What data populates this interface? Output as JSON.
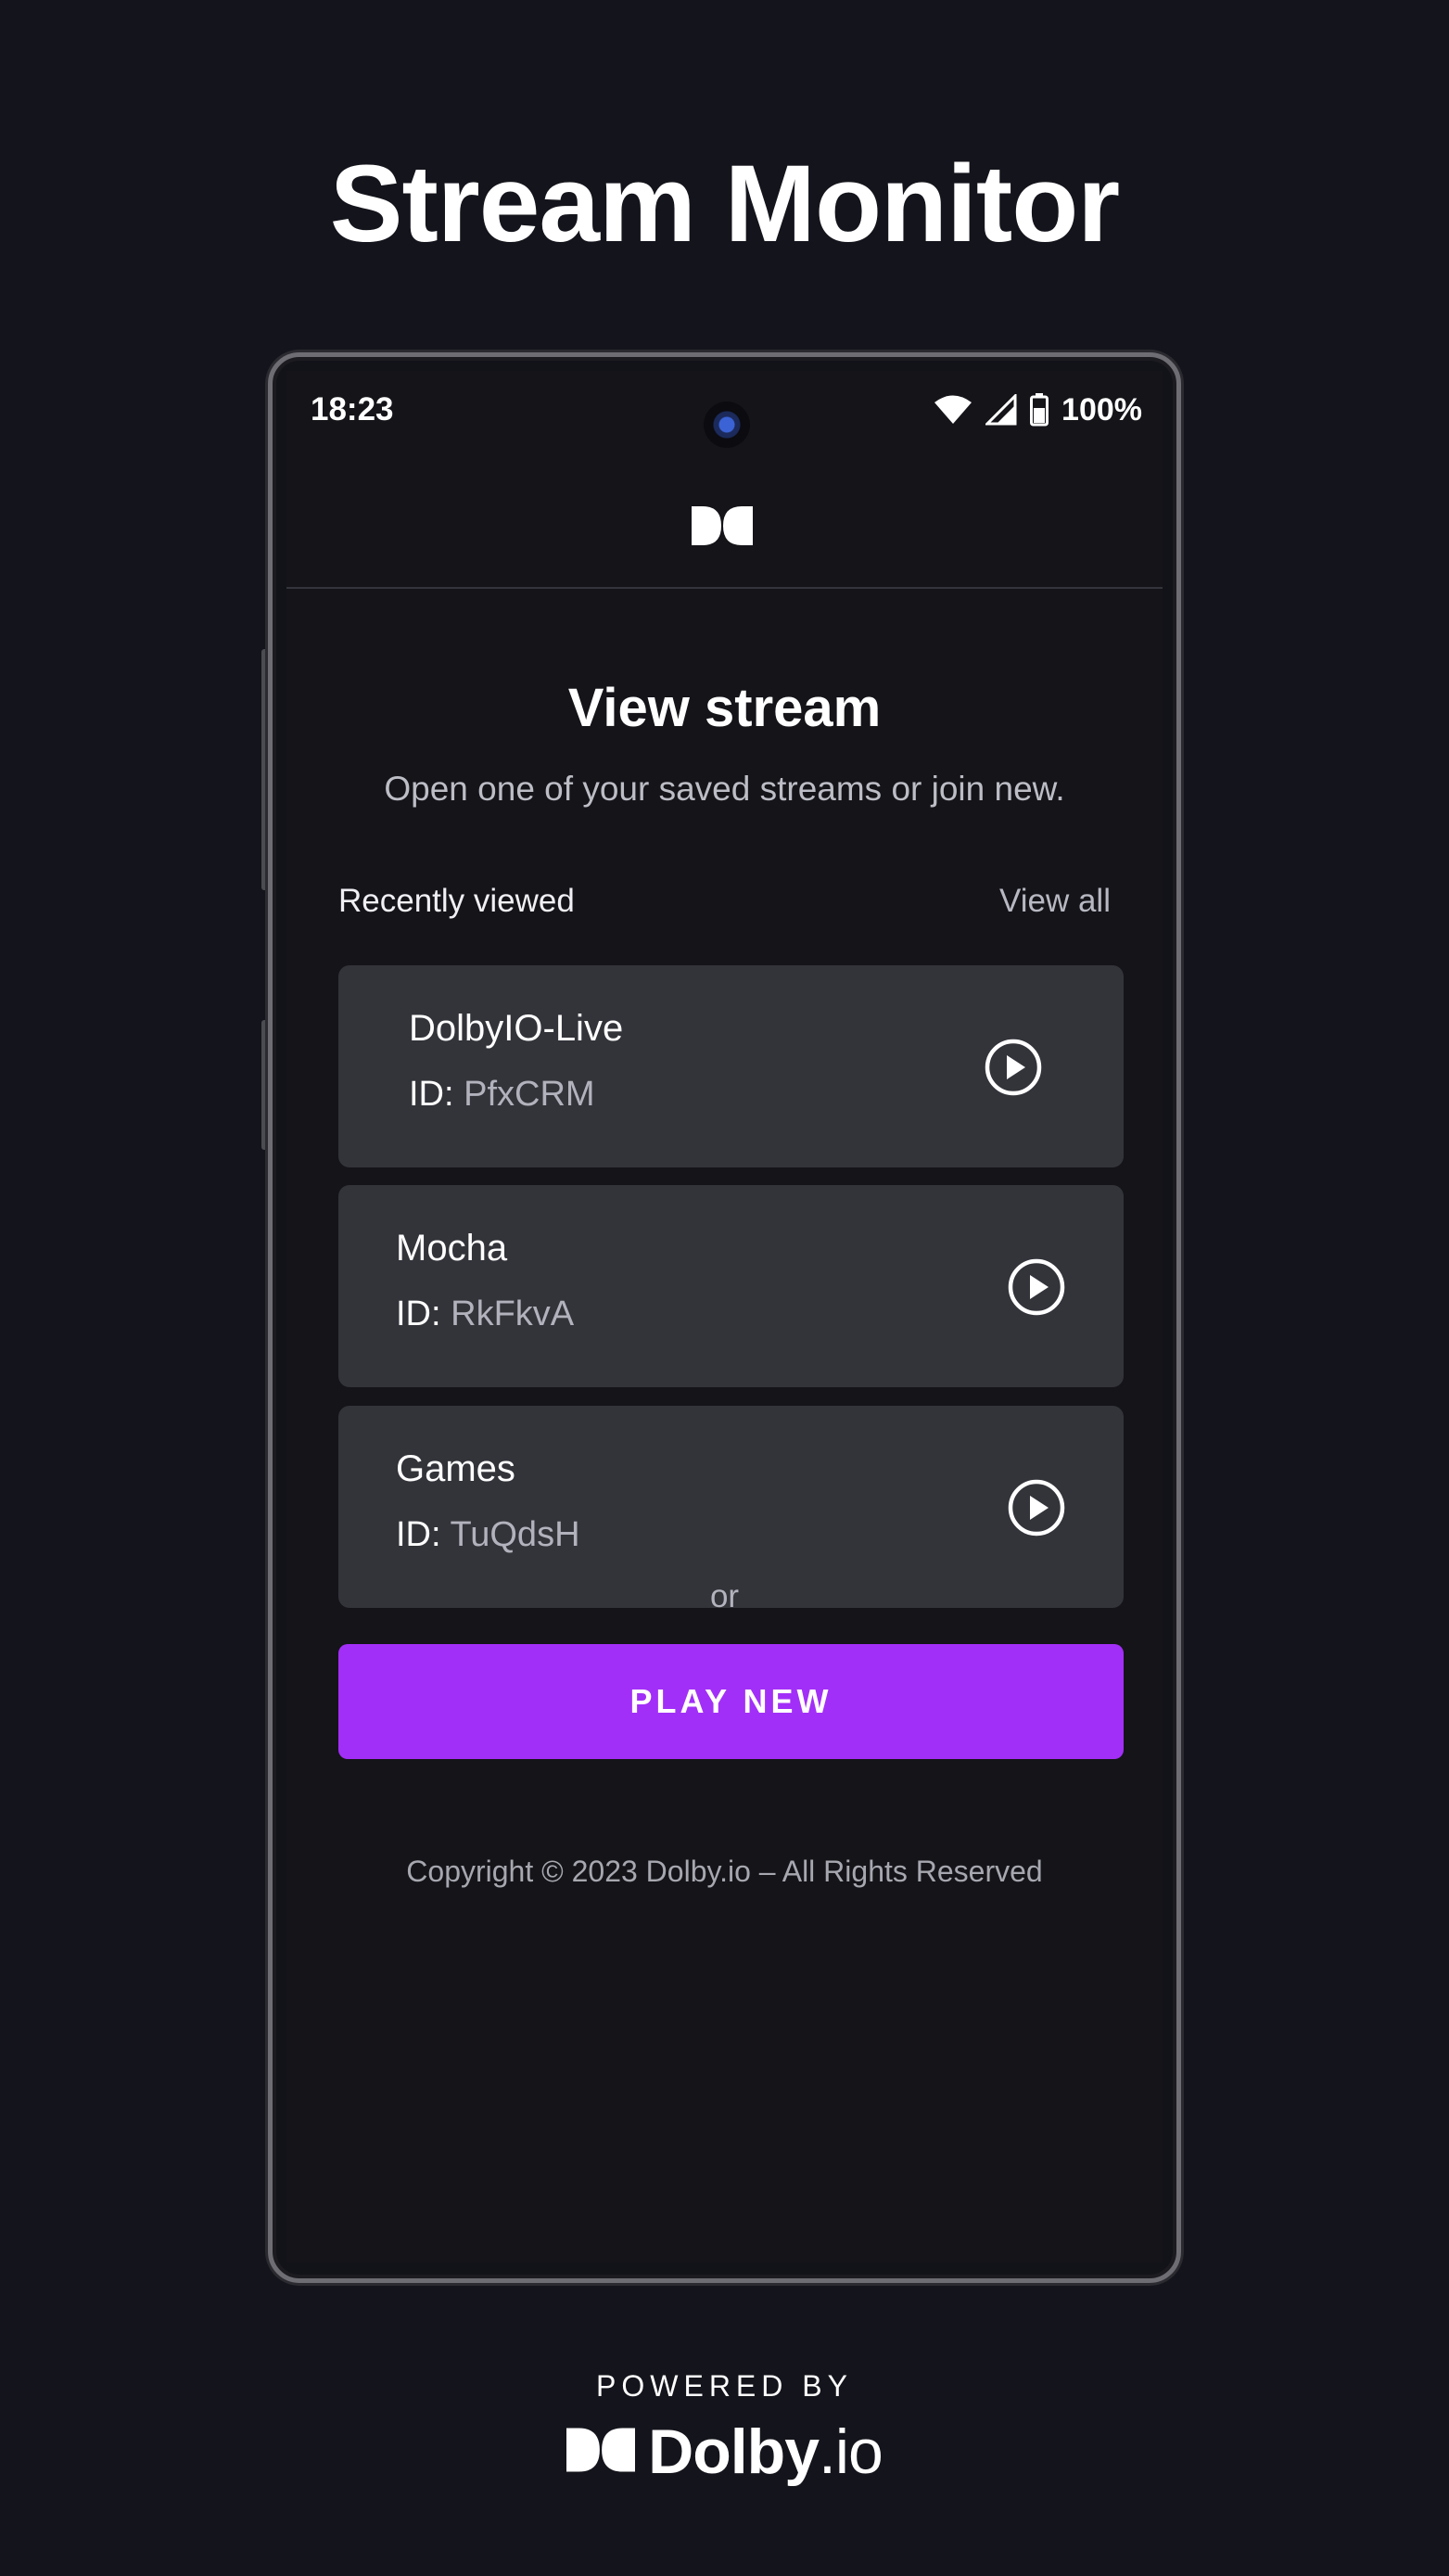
{
  "hero": {
    "title": "Stream Monitor"
  },
  "status_bar": {
    "time": "18:23",
    "battery": "100%",
    "icons": [
      "wifi-icon",
      "signal-icon",
      "battery-icon"
    ]
  },
  "header": {
    "logo": "dolby-logo-icon"
  },
  "main": {
    "title": "View stream",
    "subtitle": "Open one of your saved streams or join new.",
    "recent_label": "Recently viewed",
    "view_all_label": "View all",
    "streams": [
      {
        "name": "DolbyIO-Live",
        "id_label": "ID:",
        "id_value": "PfxCRM"
      },
      {
        "name": "Mocha",
        "id_label": "ID:",
        "id_value": "RkFkvA"
      },
      {
        "name": "Games",
        "id_label": "ID:",
        "id_value": "TuQdsH"
      }
    ],
    "or_label": "or",
    "play_new_label": "PLAY NEW",
    "copyright": "Copyright © 2023 Dolby.io – All Rights Reserved"
  },
  "footer": {
    "powered_by": "POWERED BY",
    "brand_main": "Dolby",
    "brand_suffix": ".io"
  },
  "colors": {
    "background": "#14141c",
    "card": "#33343a",
    "accent": "#a22ff7",
    "muted_text": "#b3b3bd"
  }
}
